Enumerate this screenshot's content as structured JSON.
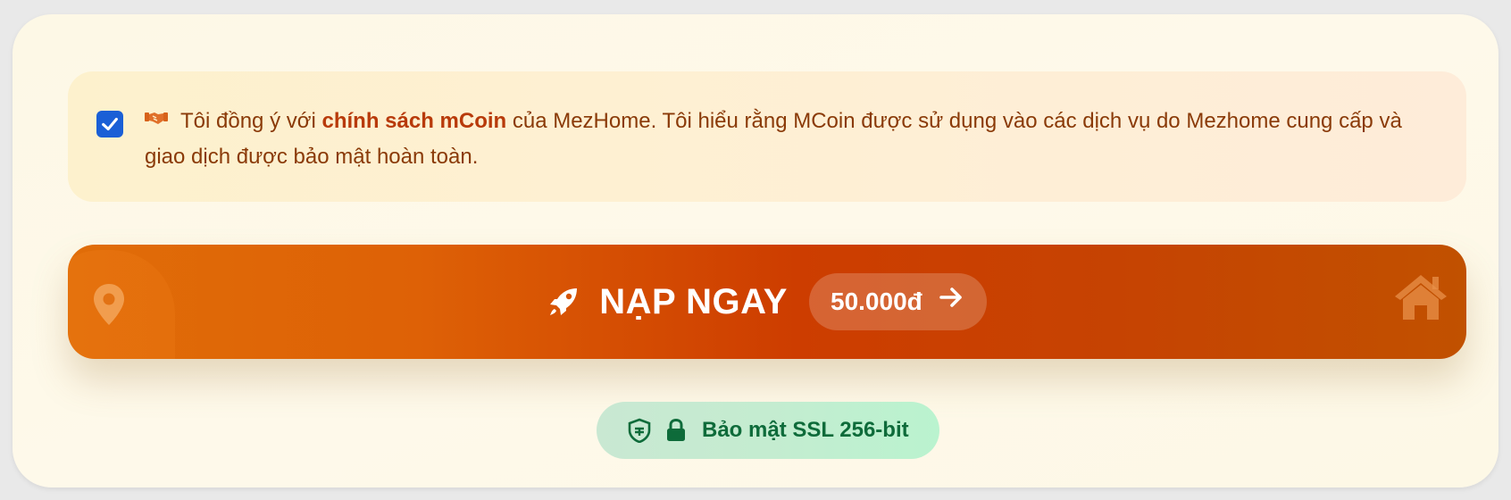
{
  "agreement": {
    "checked": true,
    "text_before": "Tôi đồng ý với ",
    "policy_link": "chính sách mCoin",
    "text_after": " của MezHome. Tôi hiểu rằng MCoin được sử dụng vào các dịch vụ do Mezhome cung cấp và giao dịch được bảo mật hoàn toàn.",
    "icon": "handshake-icon"
  },
  "cta": {
    "label": "NẠP NGAY",
    "amount": "50.000đ",
    "icons": [
      "rocket-icon",
      "arrow-right-icon",
      "map-pin-icon",
      "house-icon"
    ]
  },
  "security": {
    "label": "Bảo mật SSL 256-bit",
    "icons": [
      "shield-icon",
      "lock-icon"
    ]
  },
  "colors": {
    "checkbox": "#1a5fd6",
    "text": "#8a3a08",
    "cta_start": "#e06d08",
    "cta_mid": "#cd3d00",
    "cta_end": "#c15100",
    "ssl_text": "#0e6b3a"
  }
}
